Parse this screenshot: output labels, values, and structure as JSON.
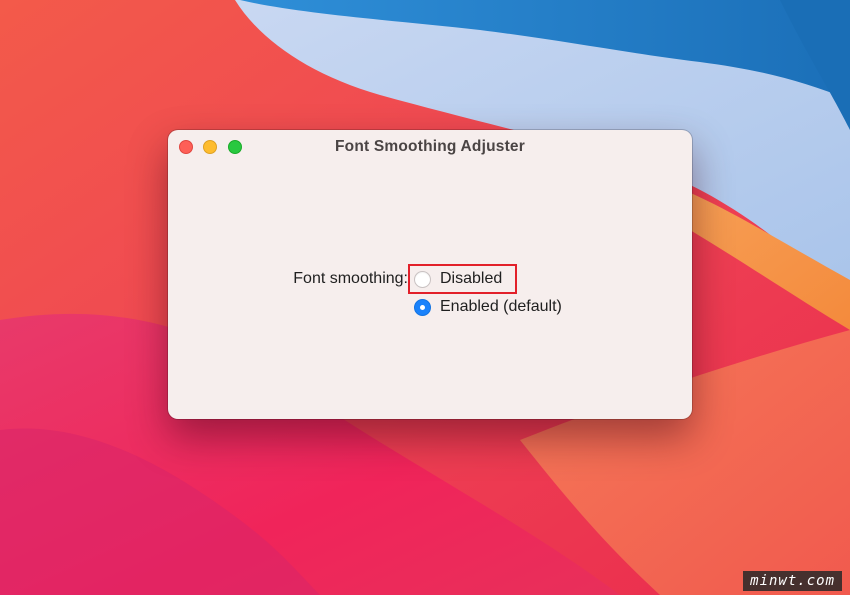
{
  "window": {
    "title": "Font Smoothing Adjuster"
  },
  "form": {
    "label": "Font smoothing:",
    "options": [
      {
        "label": "Disabled",
        "selected": false
      },
      {
        "label": "Enabled (default)",
        "selected": true
      }
    ]
  },
  "watermark": "minwt.com",
  "colors": {
    "accent": "#1a82fb",
    "highlight_box": "#e2202a",
    "window_bg": "#f6eeed",
    "traffic_close": "#fe5f57",
    "traffic_minimize": "#febc2e",
    "traffic_zoom": "#28c840"
  }
}
